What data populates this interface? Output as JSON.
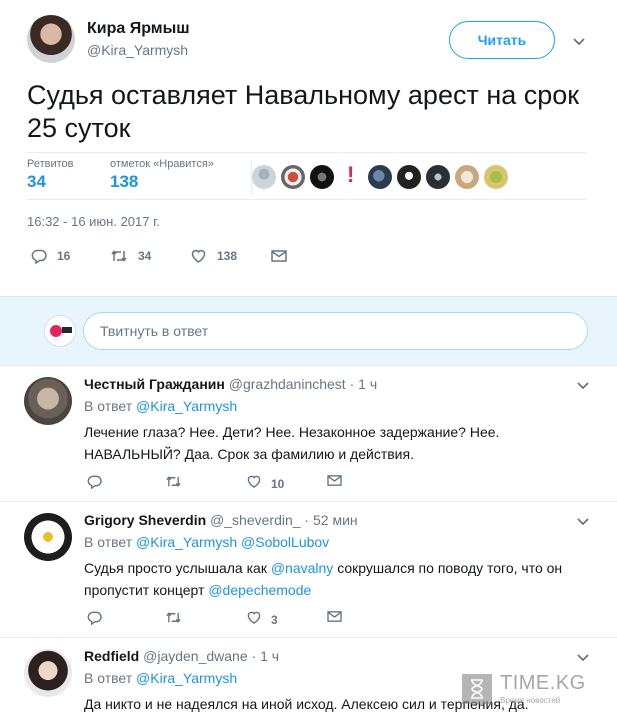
{
  "tweet": {
    "author_name": "Кира Ярмыш",
    "author_handle": "@Kira_Yarmysh",
    "follow_label": "Читать",
    "text": "Судья оставляет Навальному арест на срок 25 суток",
    "stats": {
      "retweets_label": "Ретвитов",
      "retweets_value": "34",
      "likes_label": "отметок «Нравится»",
      "likes_value": "138"
    },
    "timestamp": "16:32 - 16 июн. 2017 г.",
    "actions": {
      "replies": "16",
      "retweets": "34",
      "likes": "138"
    }
  },
  "reply_composer": {
    "placeholder": "Твитнуть в ответ"
  },
  "replies": [
    {
      "name": "Честный Гражданин",
      "handle": "@grazhdaninchest",
      "sep": " · ",
      "time": "1 ч",
      "in_reply_prefix": "В ответ ",
      "in_reply_to": [
        "@Kira_Yarmysh"
      ],
      "text_parts": [
        {
          "t": "Лечение глаза? Нее. Дети? Нее. Незаконное задержание? Нее. НАВАЛЬНЫЙ? Даа. Срок за фамилию и действия.",
          "link": false
        }
      ],
      "actions": {
        "replies": "",
        "retweets": "",
        "likes": "10"
      }
    },
    {
      "name": "Grigory Sheverdin",
      "handle": "@_sheverdin_",
      "sep": " · ",
      "time": "52 мин",
      "in_reply_prefix": "В ответ ",
      "in_reply_to": [
        "@Kira_Yarmysh",
        "@SobolLubov"
      ],
      "text_parts": [
        {
          "t": "Судья просто услышала как ",
          "link": false
        },
        {
          "t": "@navalny",
          "link": true
        },
        {
          "t": " сокрушался по поводу того, что он пропустит концерт ",
          "link": false
        },
        {
          "t": "@depechemode",
          "link": true
        }
      ],
      "actions": {
        "replies": "",
        "retweets": "",
        "likes": "3"
      }
    },
    {
      "name": "Redfield",
      "handle": "@jayden_dwane",
      "sep": " · ",
      "time": "1 ч",
      "in_reply_prefix": "В ответ ",
      "in_reply_to": [
        "@Kira_Yarmysh"
      ],
      "text_parts": [
        {
          "t": "Да никто и не надеялся на иной исход. Алексею сил и терпения, да.",
          "link": false
        }
      ],
      "actions": {
        "replies": "",
        "retweets": "",
        "likes": ""
      }
    }
  ],
  "watermark": {
    "title": "TIME.KG",
    "subtitle": "Время новостей"
  },
  "colors": {
    "accent": "#1da1f2",
    "link": "#1b95e0",
    "muted": "#657786",
    "reply_bg": "#e8f5fd"
  }
}
